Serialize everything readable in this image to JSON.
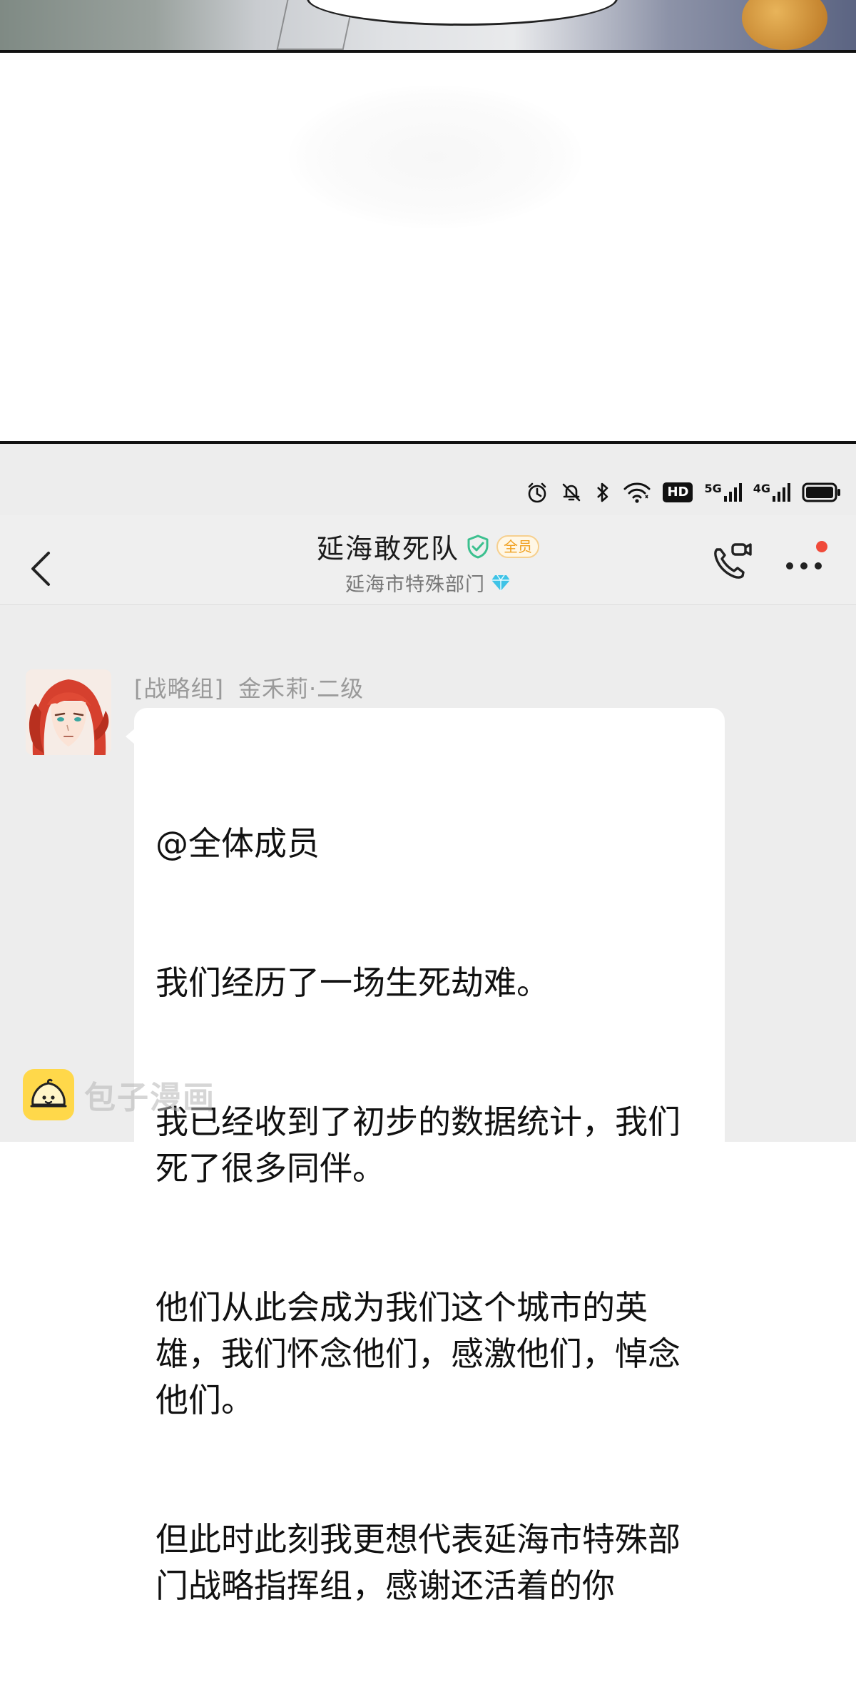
{
  "status_bar": {
    "icons": [
      "alarm-icon",
      "mute-bell-icon",
      "bluetooth-icon",
      "wifi-icon",
      "hd-icon",
      "5g-signal-icon",
      "4g-signal-icon",
      "battery-icon"
    ],
    "hd_label": "HD",
    "net1": "5G",
    "net2": "4G"
  },
  "header": {
    "back_icon": "chevron-left-icon",
    "title": "延海敢死队",
    "verified_icon": "shield-check-icon",
    "badge": "全员",
    "subtitle": "延海市特殊部门",
    "diamond_icon": "diamond-icon",
    "call_icon": "video-call-icon",
    "more_icon": "more-dots-icon",
    "accent_color": "#3cc08f",
    "badge_color": "#f0a020",
    "notify_color": "#f04a3a"
  },
  "message": {
    "sender_group": "[战略组]",
    "sender_name": "金禾莉·二级",
    "lines": [
      "@全体成员",
      "我们经历了一场生死劫难。",
      "我已经收到了初步的数据统计，我们死了很多同伴。",
      "他们从此会成为我们这个城市的英雄，我们怀念他们，感激他们，悼念他们。",
      "但此时此刻我更想代表延海市特殊部门战略指挥组，感谢还活着的你"
    ]
  },
  "watermark": {
    "text": "包子漫画"
  }
}
